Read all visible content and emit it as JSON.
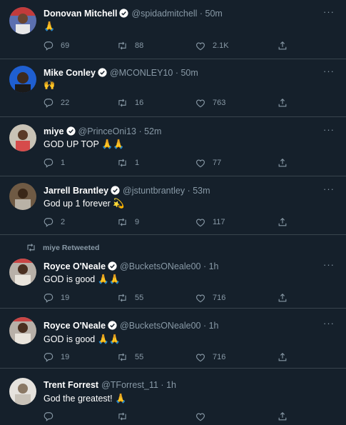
{
  "tweets": [
    {
      "name": "Donovan Mitchell",
      "handle": "@spidadmitchell",
      "time": "50m",
      "text": "",
      "emoji": "🙏",
      "replies": "69",
      "retweets": "88",
      "likes": "2.1K",
      "avatar_bg": "#5b6fb0"
    },
    {
      "name": "Mike Conley",
      "handle": "@MCONLEY10",
      "time": "50m",
      "text": "",
      "emoji": "🙌",
      "replies": "22",
      "retweets": "16",
      "likes": "763",
      "avatar_bg": "#1f5fd1"
    },
    {
      "name": "miye",
      "handle": "@PrinceOni13",
      "time": "52m",
      "text": "GOD UP TOP",
      "emoji": "🙏🙏",
      "replies": "1",
      "retweets": "1",
      "likes": "77",
      "avatar_bg": "#c9c3b6"
    },
    {
      "name": "Jarrell Brantley",
      "handle": "@jstuntbrantley",
      "time": "53m",
      "text": "God up 1 forever",
      "emoji": "💫",
      "replies": "2",
      "retweets": "9",
      "likes": "117",
      "avatar_bg": "#6f5a44"
    },
    {
      "retweeted_by": "miye Retweeted",
      "name": "Royce O'Neale",
      "handle": "@BucketsONeale00",
      "time": "1h",
      "text": "GOD is good",
      "emoji": "🙏🙏",
      "replies": "19",
      "retweets": "55",
      "likes": "716",
      "avatar_bg": "#b8b0a8"
    },
    {
      "name": "Royce O'Neale",
      "handle": "@BucketsONeale00",
      "time": "1h",
      "text": "GOD is good",
      "emoji": "🙏🙏",
      "replies": "19",
      "retweets": "55",
      "likes": "716",
      "avatar_bg": "#b8b0a8"
    },
    {
      "name": "Trent Forrest",
      "handle": "@TForrest_11",
      "time": "1h",
      "text": "God the greatest!",
      "emoji": "🙏",
      "replies": "",
      "retweets": "",
      "likes": "",
      "avatar_bg": "#e6e3de"
    }
  ],
  "icons": {
    "reply": "reply-icon",
    "retweet": "retweet-icon",
    "like": "heart-icon",
    "share": "share-icon",
    "verified": "verified-badge-icon",
    "more": "more-icon"
  },
  "colors": {
    "background": "#15202b",
    "divider": "#38444d",
    "muted": "#8899a6",
    "verified": "#ffffff"
  }
}
